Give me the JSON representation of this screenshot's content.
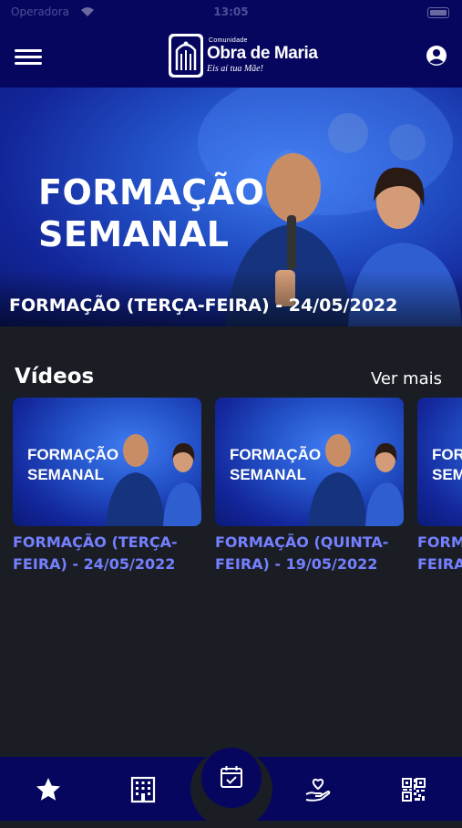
{
  "status_bar": {
    "carrier": "Operadora",
    "time": "13:05"
  },
  "header": {
    "logo_small": "Comunidade",
    "logo_big": "Obra de Maria",
    "logo_tagline": "Eis aí tua Mãe!"
  },
  "banner": {
    "title": "FORMAÇÃO\nSEMANAL",
    "caption": "FORMAÇÃO (TERÇA-FEIRA) - 24/05/2022"
  },
  "videos_section": {
    "title": "Vídeos",
    "see_more": "Ver mais",
    "items": [
      {
        "thumb_title": "FORMAÇÃO\nSEMANAL",
        "caption": "FORMAÇÃO (TERÇA-FEIRA) - 24/05/2022"
      },
      {
        "thumb_title": "FORMAÇÃO\nSEMANAL",
        "caption": "FORMAÇÃO (QUINTA-FEIRA) - 19/05/2022"
      },
      {
        "thumb_title": "FORMAÇÃO\nSEMANAL",
        "caption": "FORMAÇÃO (TERÇA-FEIRA)"
      }
    ]
  },
  "tab_bar": {
    "items": [
      {
        "icon": "star-icon"
      },
      {
        "icon": "building-icon"
      },
      {
        "icon": "calendar-check-icon"
      },
      {
        "icon": "heart-hand-icon"
      },
      {
        "icon": "qr-code-icon"
      }
    ]
  },
  "colors": {
    "primary": "#06065f",
    "background": "#1a1d24",
    "link": "#7480ff"
  }
}
